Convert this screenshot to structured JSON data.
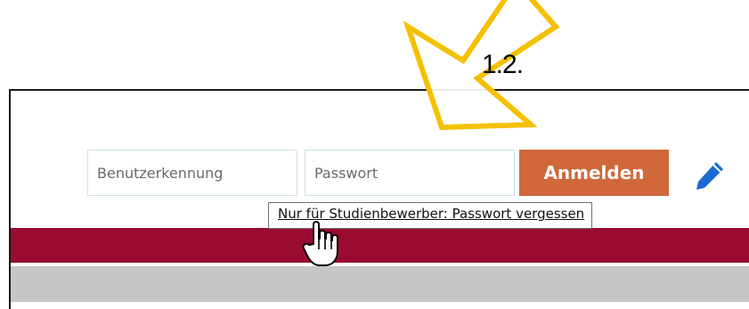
{
  "login": {
    "username_placeholder": "Benutzerkennung",
    "password_placeholder": "Passwort",
    "submit_label": "Anmelden"
  },
  "tooltip": {
    "text": "Nur für Studienbewerber: Passwort vergessen"
  },
  "annotation": {
    "step_label": "1.2."
  },
  "icons": {
    "edit": "pencil-icon",
    "cursor": "hand-pointer-icon",
    "arrow": "arrow-down-left-icon"
  },
  "colors": {
    "login_button": "#d0683a",
    "nav_band": "#9a0b31",
    "gray_band": "#c6c6c6",
    "edit_icon": "#1a6ad1",
    "arrow_stroke": "#f5c000"
  }
}
